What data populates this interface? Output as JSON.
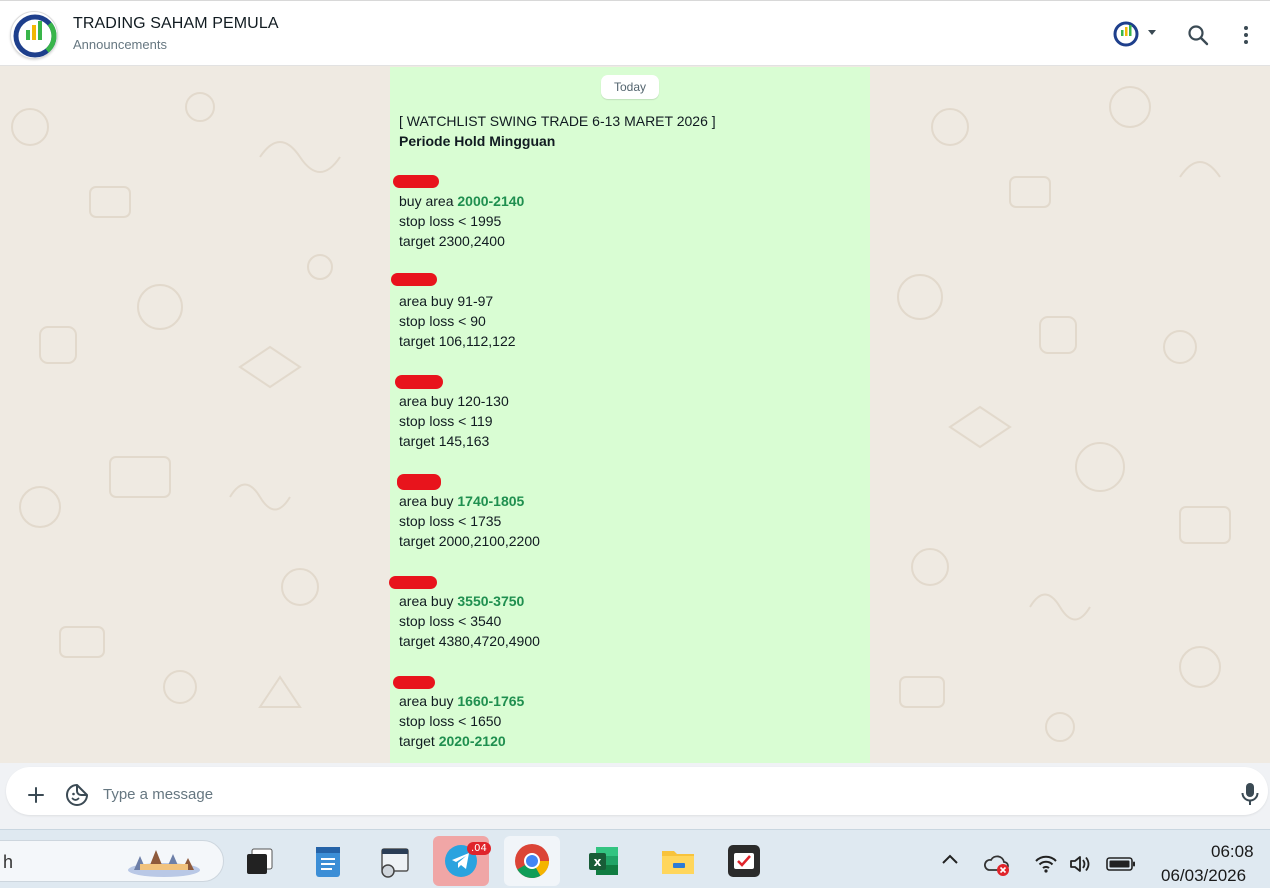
{
  "header": {
    "title": "TRADING SAHAM PEMULA",
    "subtitle": "Announcements"
  },
  "chat": {
    "date_chip": "Today",
    "message": {
      "heading": "[ WATCHLIST SWING TRADE 6-13 MARET 2026 ]",
      "subheading": "Periode Hold Mingguan",
      "blocks": [
        {
          "buy_label": "buy area ",
          "buy_range": "2000-2140",
          "buy_highlight": true,
          "stop_loss": "stop loss < 1995",
          "target_label": "target ",
          "target_value": "2300,2400",
          "target_highlight": false
        },
        {
          "buy_label": "area buy ",
          "buy_range": "91-97",
          "buy_highlight": false,
          "stop_loss": "stop loss < 90",
          "target_label": "target ",
          "target_value": "106,112,122",
          "target_highlight": false
        },
        {
          "buy_label": "area buy ",
          "buy_range": "120-130",
          "buy_highlight": false,
          "stop_loss": "stop loss < 119",
          "target_label": "target ",
          "target_value": "145,163",
          "target_highlight": false
        },
        {
          "buy_label": "area buy ",
          "buy_range": "1740-1805",
          "buy_highlight": true,
          "stop_loss": "stop loss < 1735",
          "target_label": "target ",
          "target_value": "2000,2100,2200",
          "target_highlight": false
        },
        {
          "buy_label": "area buy ",
          "buy_range": "3550-3750",
          "buy_highlight": true,
          "stop_loss": "stop loss < 3540",
          "target_label": "target ",
          "target_value": "4380,4720,4900",
          "target_highlight": false
        },
        {
          "buy_label": "area buy ",
          "buy_range": "1660-1765",
          "buy_highlight": true,
          "stop_loss": "stop loss < 1650",
          "target_label": "target ",
          "target_value": "2020-2120",
          "target_highlight": true
        }
      ]
    }
  },
  "input": {
    "placeholder": "Type a message"
  },
  "taskbar": {
    "search_text": "h",
    "telegram_badge": ".04",
    "time": "06:08",
    "date": "06/03/2026"
  },
  "colors": {
    "bubble": "#d9fdd3",
    "highlight_green": "#1f8f4f",
    "redaction": "#e8141c",
    "chat_bg": "#efeae2"
  }
}
